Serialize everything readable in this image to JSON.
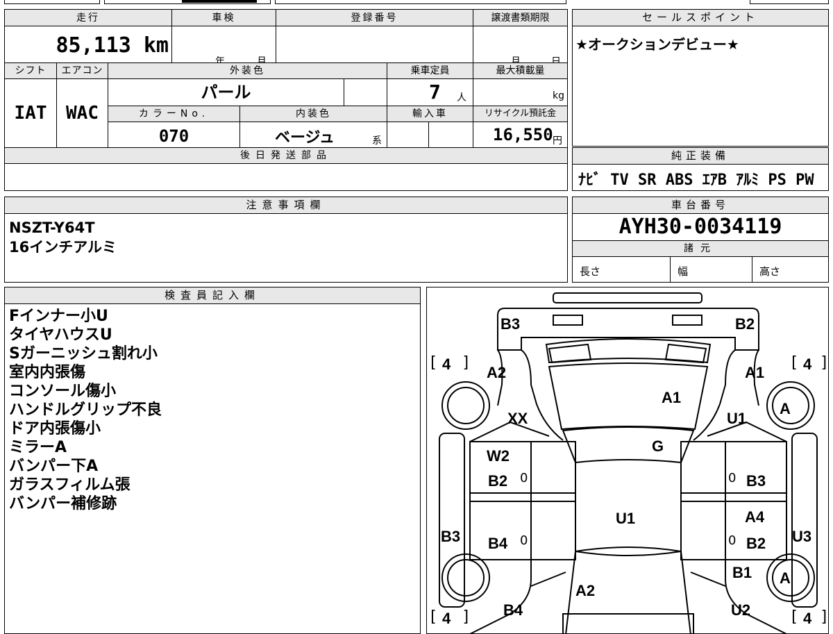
{
  "vehicle": {
    "mileage_label": "走行",
    "mileage": "85,113 km",
    "inspection_label": "車検",
    "inspection_year": "年",
    "inspection_month": "月",
    "registration_label": "登録番号",
    "transfer_label": "譲渡書類期限",
    "transfer_month": "月",
    "transfer_day": "日",
    "shift_label": "シフト",
    "shift": "IAT",
    "aircon_label": "エアコン",
    "aircon": "WAC",
    "exterior_label": "外装色",
    "exterior": "パール",
    "capacity_label": "乗車定員",
    "capacity": "7",
    "capacity_unit": "人",
    "maxload_label": "最大積載量",
    "maxload_unit": "kg",
    "color_no_label": "カラーNo.",
    "color_no": "070",
    "interior_label": "内装色",
    "interior": "ベージュ",
    "interior_suffix": "系",
    "import_label": "輸入車",
    "recycle_label": "リサイクル預託金",
    "recycle": "16,550",
    "recycle_unit": "円",
    "later_parts_label": "後日発送部品"
  },
  "sales": {
    "label": "セールスポイント",
    "text": "★オークションデビュー★"
  },
  "equipment": {
    "label": "純正装備",
    "items": "ﾅﾋﾞ TV SR ABS ｴｱB ｱﾙﾐ PS PW"
  },
  "notes": {
    "label": "注意事項欄",
    "lines": [
      "NSZT-Y64T",
      "16インチアルミ"
    ]
  },
  "chassis": {
    "label": "車台番号",
    "number": "AYH30-0034119",
    "spec_label": "諸元",
    "length": "長さ",
    "width": "幅",
    "height": "高さ"
  },
  "inspector": {
    "label": "検査員記入欄",
    "lines": [
      "Fインナー小U",
      "タイヤハウスU",
      "Sガーニッシュ割れ小",
      "室内内張傷",
      "コンソール傷小",
      "ハンドルグリップ不良",
      "ドア内張傷小",
      "ミラーA",
      "バンパー下A",
      "ガラスフィルム張",
      "バンパー補修跡"
    ]
  },
  "diagram": {
    "marks": {
      "rear_left": "B3",
      "rear_right": "B2",
      "tire_rl": "4",
      "tire_rr": "4",
      "a2_top": "A2",
      "a1_top": "A1",
      "roof": "A1",
      "xx": "XX",
      "u1_side": "U1",
      "wheel_r": "A",
      "g": "G",
      "w2": "W2",
      "b2_l": "B2",
      "b3_r": "B3",
      "u1_center": "U1",
      "a4": "A4",
      "b3_side": "B3",
      "u3_side": "U3",
      "b4_l": "B4",
      "b2_r": "B2",
      "b1": "B1",
      "wheel_fr": "A",
      "a2_front": "A2",
      "b4_front": "B4",
      "u2_front": "U2",
      "tire_fl": "4",
      "tire_fr": "4",
      "zero": "0"
    }
  }
}
